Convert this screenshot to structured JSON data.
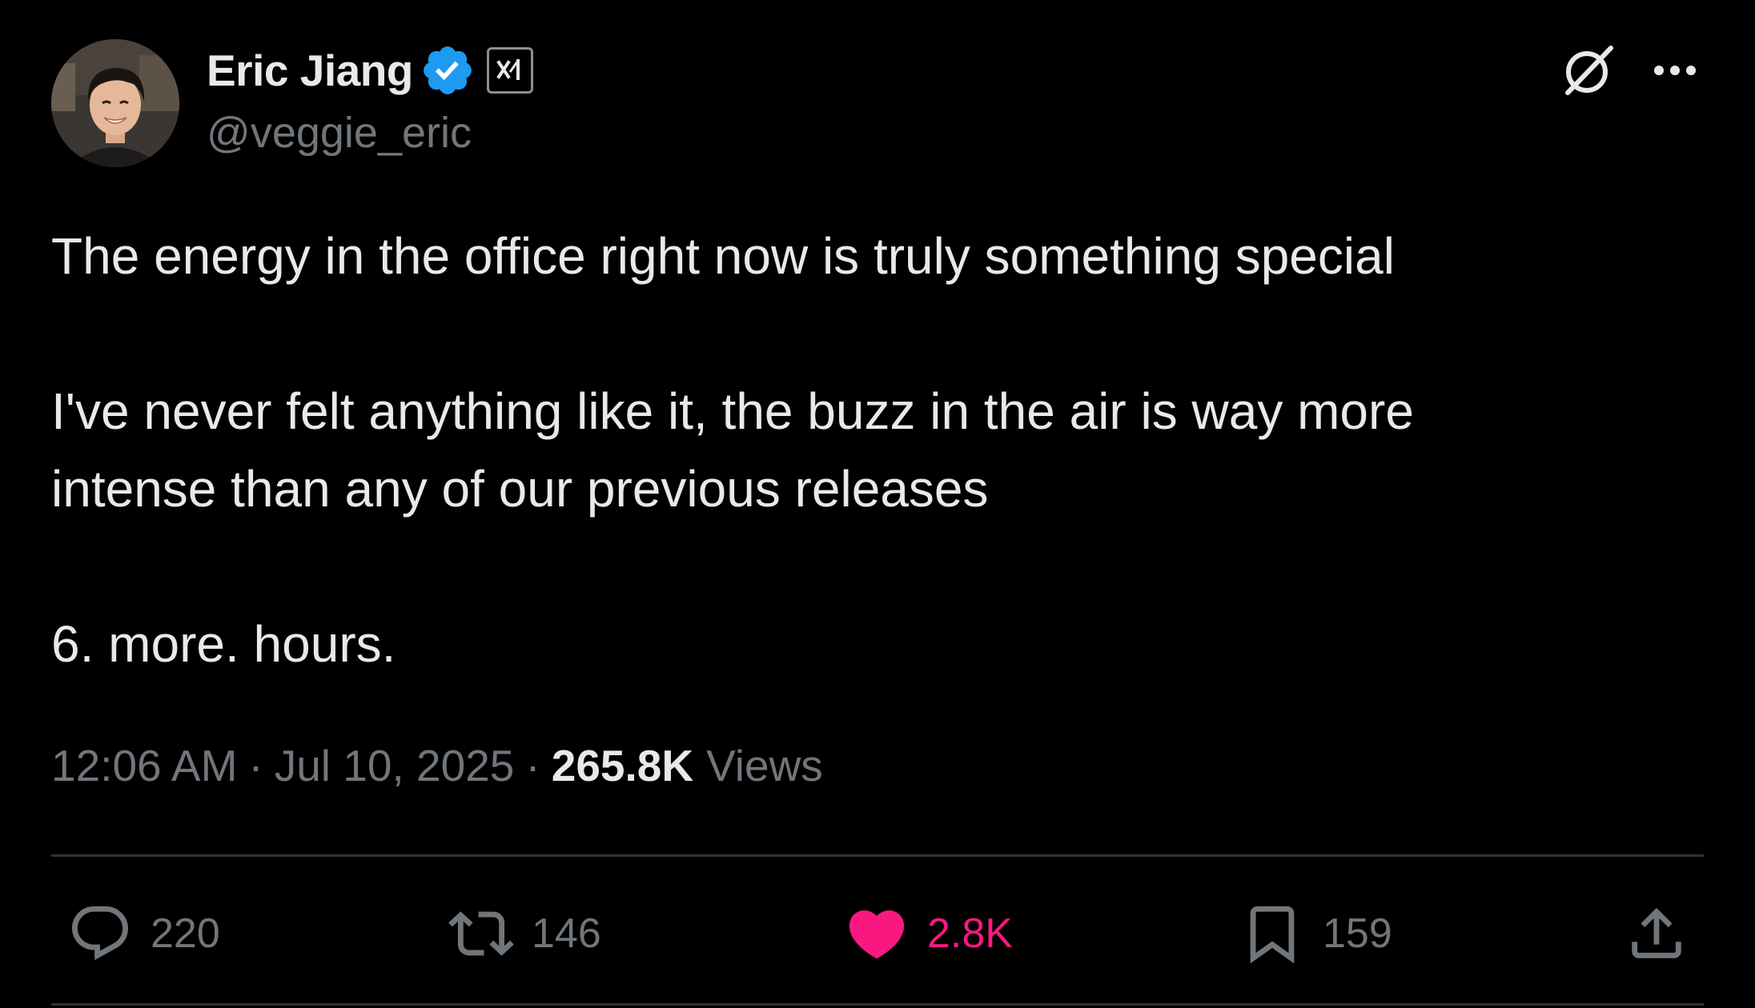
{
  "author": {
    "display_name": "Eric Jiang",
    "handle": "@veggie_eric",
    "verified": true,
    "affiliate_badge": "xAI",
    "avatar": "profile-photo"
  },
  "tweet": {
    "paragraphs": [
      "The energy in the office right now is truly something special",
      "I've never felt anything like it, the buzz in the air is way more intense than any of our previous releases",
      "6. more. hours."
    ],
    "time": "12:06 AM",
    "date": "Jul 10, 2025",
    "separator": "·",
    "views_count": "265.8K",
    "views_label": "Views"
  },
  "actions": {
    "replies": "220",
    "reposts": "146",
    "likes": "2.8K",
    "bookmarks": "159"
  },
  "header_icons": {
    "grok": "grok-icon",
    "more": "more-icon"
  },
  "colors": {
    "background": "#000000",
    "text": "#e7e9ea",
    "secondary": "#71767b",
    "verified": "#1d9bf0",
    "like": "#f91880",
    "divider": "#2f3336"
  }
}
